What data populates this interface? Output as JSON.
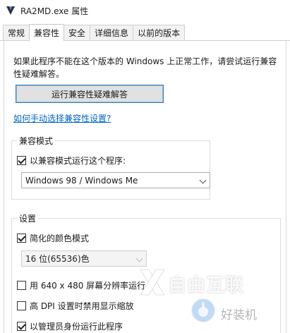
{
  "window": {
    "title": "RA2MD.exe 属性"
  },
  "tabs": [
    {
      "label": "常规"
    },
    {
      "label": "兼容性"
    },
    {
      "label": "安全"
    },
    {
      "label": "详细信息"
    },
    {
      "label": "以前的版本"
    }
  ],
  "intro_text": "如果此程序不能在这个版本的 Windows 上正常工作，请尝试运行兼容性疑难解答。",
  "troubleshoot_button": "运行兼容性疑难解答",
  "manual_link": "如何手动选择兼容性设置?",
  "compat_mode": {
    "title": "兼容模式",
    "checkbox_label": "以兼容模式运行这个程序:",
    "checked": true,
    "selected_os": "Windows 98 / Windows Me"
  },
  "settings": {
    "title": "设置",
    "reduced_color": {
      "label": "简化的颜色模式",
      "checked": true
    },
    "color_select": "16 位(65536)色",
    "res_640": {
      "label": "用 640 x 480 屏幕分辨率运行",
      "checked": false
    },
    "high_dpi": {
      "label": "高 DPI 设置时禁用显示缩放",
      "checked": false
    },
    "admin": {
      "label": "以管理员身份运行此程序",
      "checked": true
    }
  },
  "watermark": {
    "brand": "自由互联",
    "sub": "好装机"
  },
  "colors": {
    "accent": "#3c7fb1",
    "link": "#0066cc"
  }
}
